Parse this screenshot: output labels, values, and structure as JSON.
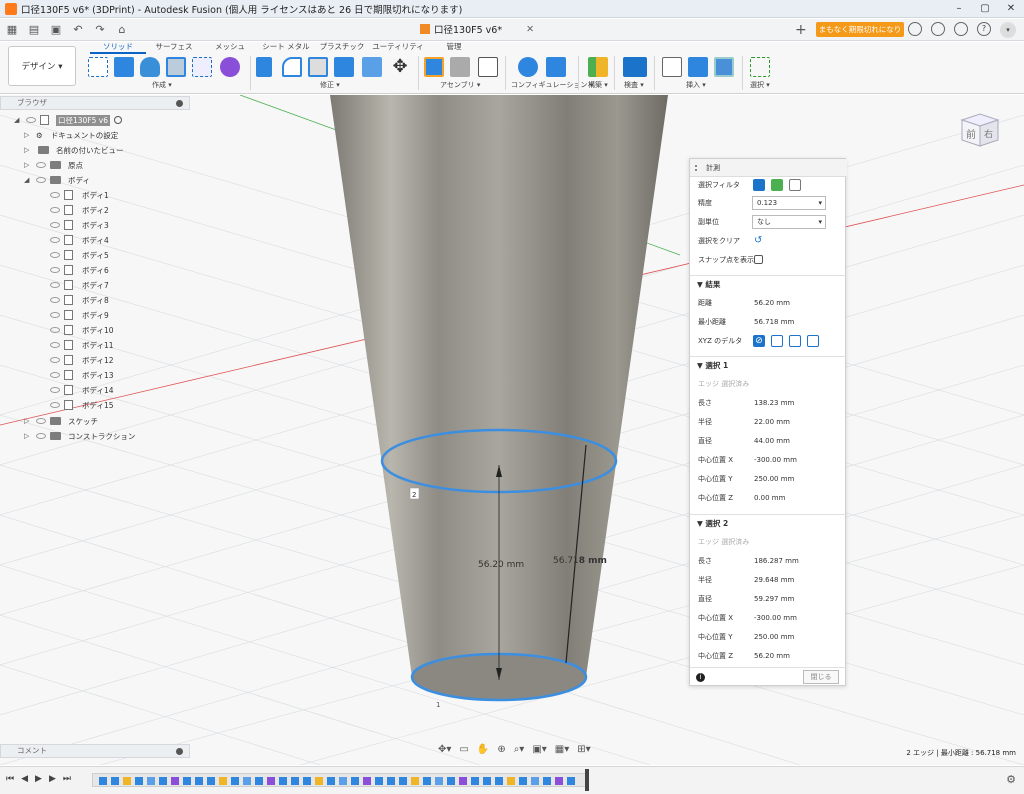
{
  "window": {
    "title": "口径130F5 v6* (3DPrint) - Autodesk Fusion (個人用 ライセンスはあと 26 日で期限切れになります)",
    "controls": [
      "–",
      "▢",
      "✕"
    ]
  },
  "tab": {
    "document_name": "口径130F5 v6*",
    "trial_button": "まもなく期限切れになります",
    "close": "✕",
    "new_tab": "+"
  },
  "ribbon": {
    "workspace": "デザイン ▾",
    "tabs": [
      "ソリッド",
      "サーフェス",
      "メッシュ",
      "シート メタル",
      "プラスチック",
      "ユーティリティ",
      "管理"
    ],
    "groups": [
      "作成 ▾",
      "修正 ▾",
      "アセンブリ ▾",
      "コンフィギュレーション ▾",
      "構築 ▾",
      "検査 ▾",
      "挿入 ▾",
      "選択 ▾"
    ]
  },
  "browser": {
    "header": "ブラウザ",
    "root": "口径130F5 v6",
    "items": [
      {
        "label": "ドキュメントの設定",
        "type": "gear"
      },
      {
        "label": "名前の付いたビュー",
        "type": "folder"
      },
      {
        "label": "原点",
        "type": "folder"
      },
      {
        "label": "ボディ",
        "type": "folder"
      }
    ],
    "bodies": [
      "ボディ1",
      "ボディ2",
      "ボディ3",
      "ボディ4",
      "ボディ5",
      "ボディ6",
      "ボディ7",
      "ボディ8",
      "ボディ9",
      "ボディ10",
      "ボディ11",
      "ボディ12",
      "ボディ13",
      "ボディ14",
      "ボディ15"
    ],
    "tail": [
      "スケッチ",
      "コンストラクション"
    ]
  },
  "viewport": {
    "dim_center": "56.20 mm",
    "dim_side_prefix": "56.71",
    "dim_side_suffix": "8 mm",
    "label_top": "2",
    "label_bottom": "1",
    "viewcube_front": "前",
    "viewcube_right": "右"
  },
  "measure": {
    "title": "計測",
    "filter_label": "選択フィルタ",
    "precision_label": "精度",
    "precision_value": "0.123",
    "subunit_label": "副単位",
    "subunit_value": "なし",
    "clear_label": "選択をクリア",
    "snap_label": "スナップ点を表示",
    "results_header": "結果",
    "distance_label": "距離",
    "distance_value": "56.20 mm",
    "min_distance_label": "最小距離",
    "min_distance_value": "56.718 mm",
    "xyz_label": "XYZ のデルタ",
    "sel1_header": "選択 1",
    "sel1_type": "エッジ 選択済み",
    "sel1": [
      {
        "k": "長さ",
        "v": "138.23 mm"
      },
      {
        "k": "半径",
        "v": "22.00 mm"
      },
      {
        "k": "直径",
        "v": "44.00 mm"
      },
      {
        "k": "中心位置 X",
        "v": "-300.00 mm"
      },
      {
        "k": "中心位置 Y",
        "v": "250.00 mm"
      },
      {
        "k": "中心位置 Z",
        "v": "0.00 mm"
      }
    ],
    "sel2_header": "選択 2",
    "sel2_type": "エッジ 選択済み",
    "sel2": [
      {
        "k": "長さ",
        "v": "186.287 mm"
      },
      {
        "k": "半径",
        "v": "29.648 mm"
      },
      {
        "k": "直径",
        "v": "59.297 mm"
      },
      {
        "k": "中心位置 X",
        "v": "-300.00 mm"
      },
      {
        "k": "中心位置 Y",
        "v": "250.00 mm"
      },
      {
        "k": "中心位置 Z",
        "v": "56.20 mm"
      }
    ],
    "close_label": "閉じる"
  },
  "bottom": {
    "comment": "コメント",
    "status": "2 エッジ | 最小距離 : 56.718 mm"
  },
  "colors": {
    "accent": "#0a64c8",
    "trial": "#f59a18",
    "selection": "#3c8fe0",
    "red_axis": "#e05050",
    "green_axis": "#4caf50"
  }
}
